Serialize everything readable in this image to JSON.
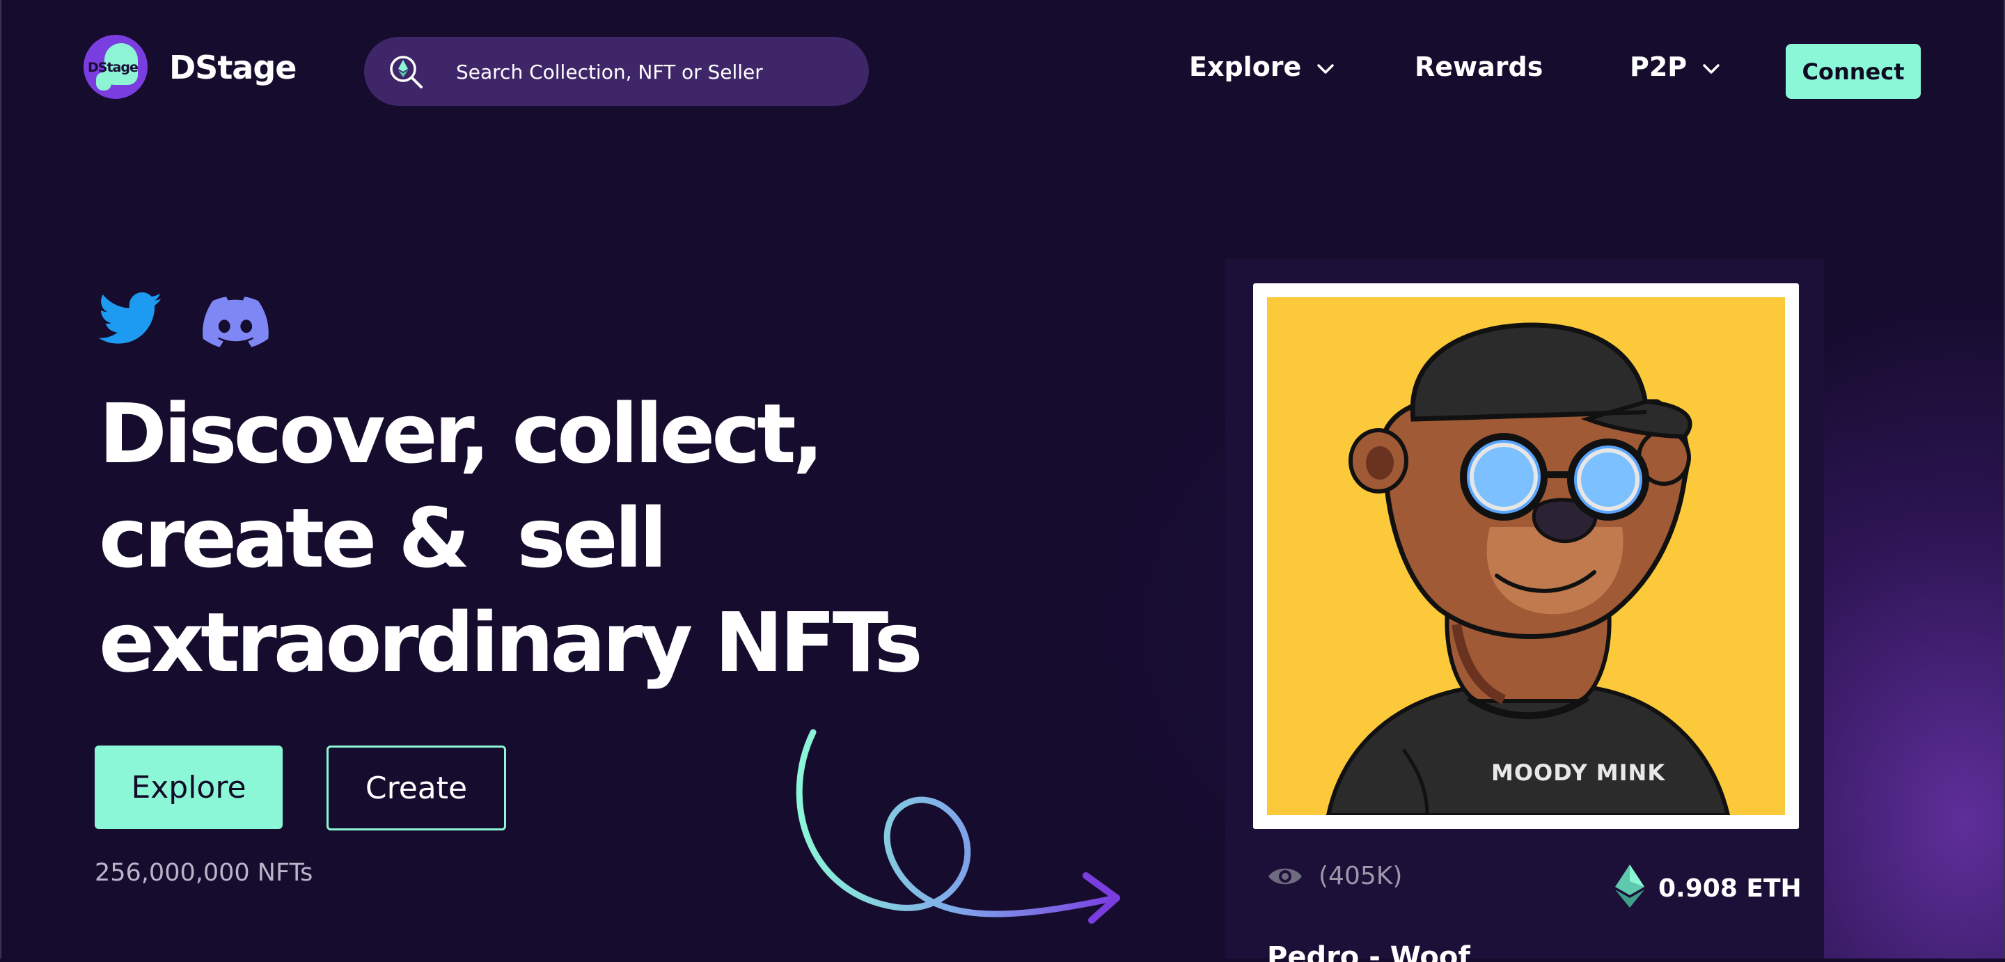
{
  "header": {
    "brand": "DStage",
    "logo_text": "DStage",
    "search_placeholder": "Search Collection, NFT or Seller",
    "nav": [
      {
        "label": "Explore",
        "has_dropdown": true
      },
      {
        "label": "Rewards",
        "has_dropdown": false
      },
      {
        "label": "P2P",
        "has_dropdown": true
      }
    ],
    "connect_label": "Connect"
  },
  "hero": {
    "social_icons": [
      "twitter-icon",
      "discord-icon"
    ],
    "headline_lines": [
      "Discover, collect,",
      "create &  sell",
      "extraordinary NFTs"
    ],
    "explore_label": "Explore",
    "create_label": "Create",
    "nft_count": "256,000,000 NFTs"
  },
  "featured_card": {
    "artwork_text": "MOODY MINK",
    "views": "(405K)",
    "price": "0.908 ETH",
    "currency_icon": "ethereum-icon",
    "title": "Pedro - Woof"
  },
  "colors": {
    "background": "#160c2e",
    "accent": "#8cf7d6",
    "search_bg": "#3e2668",
    "card_bg": "#1c0f38",
    "artwork_bg": "#fcc93a",
    "twitter": "#1d9bf0",
    "discord": "#5865f2"
  }
}
